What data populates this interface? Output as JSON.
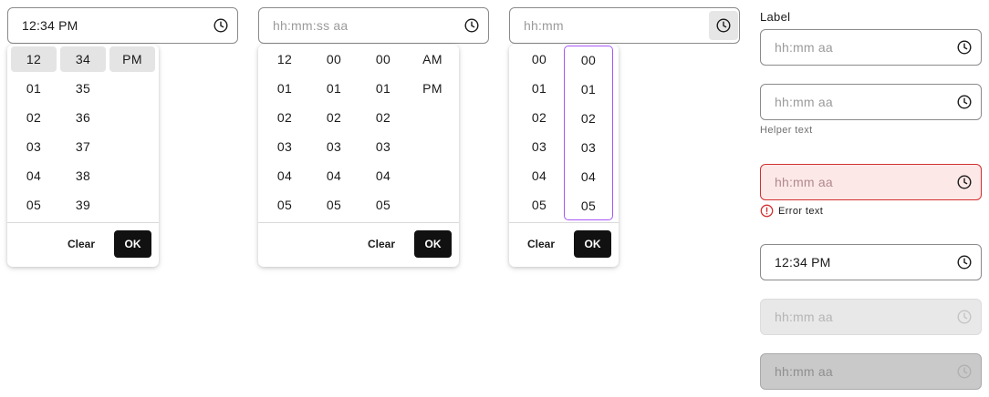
{
  "picker1": {
    "value": "12:34 PM",
    "hours": [
      "12",
      "01",
      "02",
      "03",
      "04",
      "05"
    ],
    "minutes": [
      "34",
      "35",
      "36",
      "37",
      "38",
      "39"
    ],
    "meridiem": [
      "PM"
    ],
    "clear_label": "Clear",
    "ok_label": "OK"
  },
  "picker2": {
    "placeholder": "hh:mm:ss aa",
    "hours": [
      "12",
      "01",
      "02",
      "03",
      "04",
      "05"
    ],
    "minutes": [
      "00",
      "01",
      "02",
      "03",
      "04",
      "05"
    ],
    "seconds": [
      "00",
      "01",
      "02",
      "03",
      "04",
      "05"
    ],
    "meridiem": [
      "AM",
      "PM"
    ],
    "clear_label": "Clear",
    "ok_label": "OK"
  },
  "picker3": {
    "placeholder": "hh:mm",
    "hours": [
      "00",
      "01",
      "02",
      "03",
      "04",
      "05"
    ],
    "minutes": [
      "00",
      "01",
      "02",
      "03",
      "04",
      "05"
    ],
    "clear_label": "Clear",
    "ok_label": "OK"
  },
  "variants": {
    "label": "Label",
    "default_placeholder": "hh:mm aa",
    "helper_placeholder": "hh:mm aa",
    "helper_text": "Helper text",
    "error_placeholder": "hh:mm aa",
    "error_text": "Error text",
    "filled_value": "12:34 PM",
    "disabled_placeholder": "hh:mm aa",
    "readonly_placeholder": "hh:mm aa"
  },
  "icons": {
    "clock": "clock-icon",
    "error": "error-circle-icon"
  },
  "colors": {
    "ok_button": "#111111",
    "focus_ring": "#a855f7",
    "error_border": "#d32f2f",
    "error_background": "#fde8e8",
    "selected_cell": "#e4e4e4"
  }
}
